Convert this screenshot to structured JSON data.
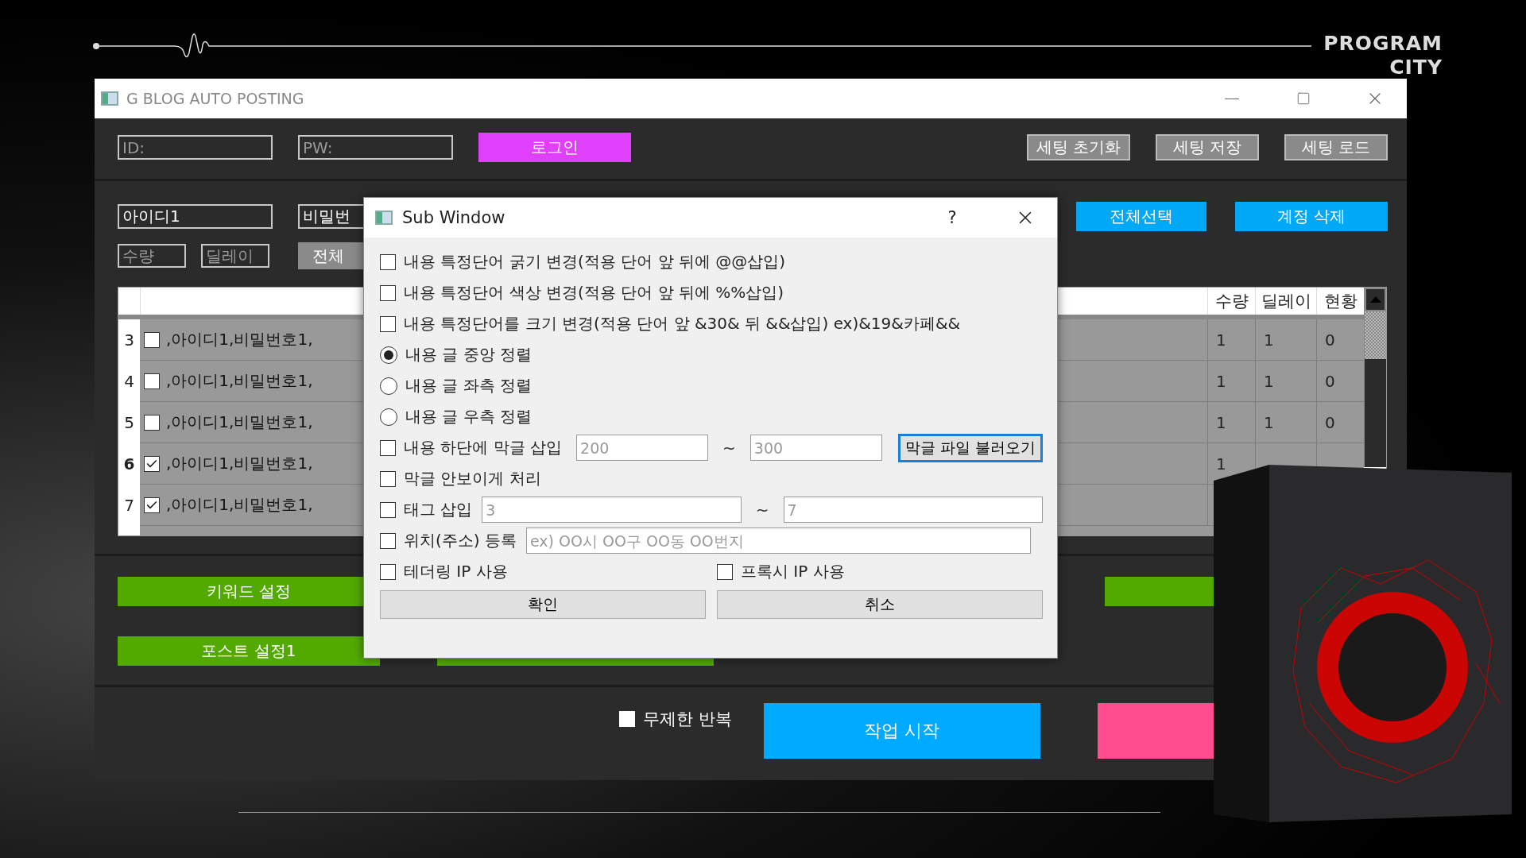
{
  "brand": {
    "lines": [
      "PROGRAM",
      "CITY"
    ]
  },
  "main_window": {
    "title": "G BLOG AUTO POSTING"
  },
  "login": {
    "id_placeholder": "ID:",
    "pw_placeholder": "PW:",
    "button": "로그인"
  },
  "settings_buttons": [
    "세팅 초기화",
    "세팅 저장",
    "세팅 로드"
  ],
  "account": {
    "id_value": "아이디1",
    "pw_value": "비밀번",
    "qty_placeholder": "수량",
    "delay_placeholder": "딜레이",
    "apply_button": "전체",
    "select_all": "전체선택",
    "delete": "계정 삭제"
  },
  "table": {
    "columns": [
      "수량",
      "딜레이",
      "현황"
    ],
    "rows": [
      {
        "number": "3",
        "checked": false,
        "current": false,
        "text": ",아이디1,비밀번호1,",
        "qty": "1",
        "delay": "1",
        "status": "0"
      },
      {
        "number": "4",
        "checked": false,
        "current": false,
        "text": ",아이디1,비밀번호1,",
        "qty": "1",
        "delay": "1",
        "status": "0"
      },
      {
        "number": "5",
        "checked": false,
        "current": false,
        "text": ",아이디1,비밀번호1,",
        "qty": "1",
        "delay": "1",
        "status": "0"
      },
      {
        "number": "6",
        "checked": true,
        "current": true,
        "text": ",아이디1,비밀번호1,",
        "qty": "1"
      },
      {
        "number": "7",
        "checked": true,
        "current": false,
        "text": ",아이디1,비밀번호1,"
      }
    ]
  },
  "setting_buttons": {
    "keyword": "키워드 설정",
    "post": "포스트 설정1"
  },
  "footer": {
    "repeat_label": "무제한 반복",
    "repeat_checked": false,
    "start": "작업 시작"
  },
  "sub_window": {
    "title": "Sub Window",
    "help": "?",
    "options": [
      {
        "kind": "checkbox",
        "label": "내용 특정단어 굵기 변경(적용 단어 앞 뒤에 @@삽입)",
        "checked": false
      },
      {
        "kind": "checkbox",
        "label": "내용 특정단어 색상 변경(적용 단어 앞 뒤에 %%삽입)",
        "checked": false
      },
      {
        "kind": "checkbox",
        "label": "내용 특정단어를 크기 변경(적용 단어 앞 &30& 뒤 &&삽입) ex)&19&카페&&",
        "checked": false
      },
      {
        "kind": "radio",
        "label": "내용 글 중앙 정렬",
        "selected": true
      },
      {
        "kind": "radio",
        "label": "내용 글 좌측 정렬",
        "selected": false
      },
      {
        "kind": "radio",
        "label": "내용 글 우측 정렬",
        "selected": false
      },
      {
        "kind": "range",
        "label": "내용 하단에 막글 삽입",
        "checked": false,
        "from": {
          "placeholder": "200"
        },
        "separator": "~",
        "to": {
          "placeholder": "300"
        },
        "button": "막글 파일 불러오기"
      },
      {
        "kind": "checkbox",
        "label": "막글 안보이게 처리",
        "checked": false
      },
      {
        "kind": "range",
        "label": "태그 삽입",
        "checked": false,
        "from": {
          "placeholder": "3"
        },
        "separator": "~",
        "to": {
          "placeholder": "7"
        }
      },
      {
        "kind": "field",
        "label": "위치(주소) 등록",
        "checked": false,
        "placeholder": "ex) OO시 OO구 OO동 OO번지"
      },
      {
        "kind": "pair",
        "items": [
          {
            "label": "테더링 IP 사용",
            "checked": false
          },
          {
            "label": "프록시 IP 사용",
            "checked": false
          }
        ]
      }
    ],
    "buttons": [
      "확인",
      "취소"
    ]
  }
}
